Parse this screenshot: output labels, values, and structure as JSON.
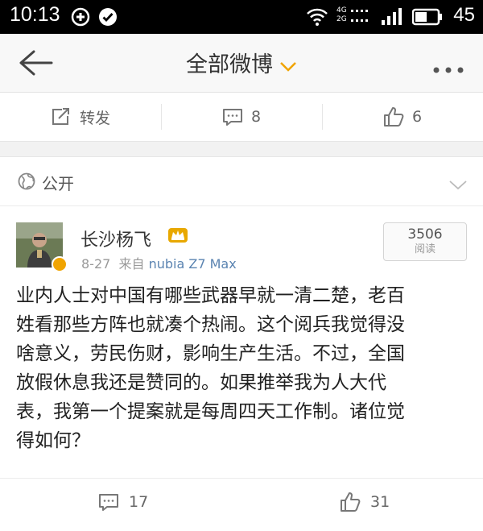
{
  "status_bar": {
    "time": "10:13",
    "network_label_top": "4G",
    "network_label_bottom": "2G",
    "battery_percent": "45"
  },
  "header": {
    "title": "全部微博"
  },
  "prev_post_actions": {
    "repost_label": "转发",
    "comment_count": "8",
    "like_count": "6"
  },
  "post": {
    "visibility": "公开",
    "author": "长沙杨飞",
    "date": "8-27",
    "source_prefix": "来自",
    "source": "nubia Z7 Max",
    "read_count": "3506",
    "read_label": "阅读",
    "body": "业内人士对中国有哪些武器早就一清二楚，老百\n姓看那些方阵也就凑个热闹。这个阅兵我觉得没\n啥意义，劳民伤财，影响生产生活。不过，全国\n放假休息我还是赞同的。如果推举我为人大代\n表，我第一个提案就是每周四天工作制。诸位觉\n得如何？",
    "comment_count": "17",
    "like_count": "31"
  },
  "colors": {
    "accent_orange": "#f0a400",
    "link_blue": "#5b84b1",
    "crown": "#e8a800"
  },
  "icons": [
    "wifi-icon",
    "signal-icon",
    "battery-icon",
    "back-arrow-icon",
    "more-icon",
    "repost-icon",
    "comment-icon",
    "like-icon",
    "globe-icon",
    "chevron-down-icon",
    "crown-icon",
    "verified-badge-icon"
  ]
}
